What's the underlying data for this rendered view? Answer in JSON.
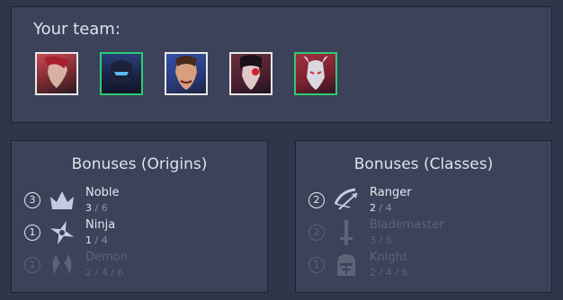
{
  "team": {
    "title": "Your team:",
    "champions": [
      {
        "icon": "champion-portrait-1",
        "border": "white",
        "bg": "#7a2a2e"
      },
      {
        "icon": "champion-portrait-2",
        "border": "green",
        "bg": "#1d2f5a"
      },
      {
        "icon": "champion-portrait-3",
        "border": "white",
        "bg": "#2a3a78"
      },
      {
        "icon": "champion-portrait-4",
        "border": "white",
        "bg": "#4a1f2e"
      },
      {
        "icon": "champion-portrait-5",
        "border": "green",
        "bg": "#7d2230"
      }
    ]
  },
  "origins": {
    "title": "Bonuses (Origins)",
    "traits": [
      {
        "count": "3",
        "name": "Noble",
        "icon": "crown-icon",
        "tiers": [
          "3",
          "6"
        ],
        "active_tier": 0,
        "inactive": false
      },
      {
        "count": "1",
        "name": "Ninja",
        "icon": "shuriken-icon",
        "tiers": [
          "1",
          "4"
        ],
        "active_tier": 0,
        "inactive": false
      },
      {
        "count": "1",
        "name": "Demon",
        "icon": "demon-horns-icon",
        "tiers": [
          "2",
          "4",
          "6"
        ],
        "active_tier": -1,
        "inactive": true
      }
    ]
  },
  "classes": {
    "title": "Bonuses (Classes)",
    "traits": [
      {
        "count": "2",
        "name": "Ranger",
        "icon": "bow-icon",
        "tiers": [
          "2",
          "4"
        ],
        "active_tier": 0,
        "inactive": false
      },
      {
        "count": "2",
        "name": "Blademaster",
        "icon": "sword-icon",
        "tiers": [
          "3",
          "6"
        ],
        "active_tier": -1,
        "inactive": true
      },
      {
        "count": "1",
        "name": "Knight",
        "icon": "helmet-icon",
        "tiers": [
          "2",
          "4",
          "6"
        ],
        "active_tier": -1,
        "inactive": true
      }
    ]
  }
}
